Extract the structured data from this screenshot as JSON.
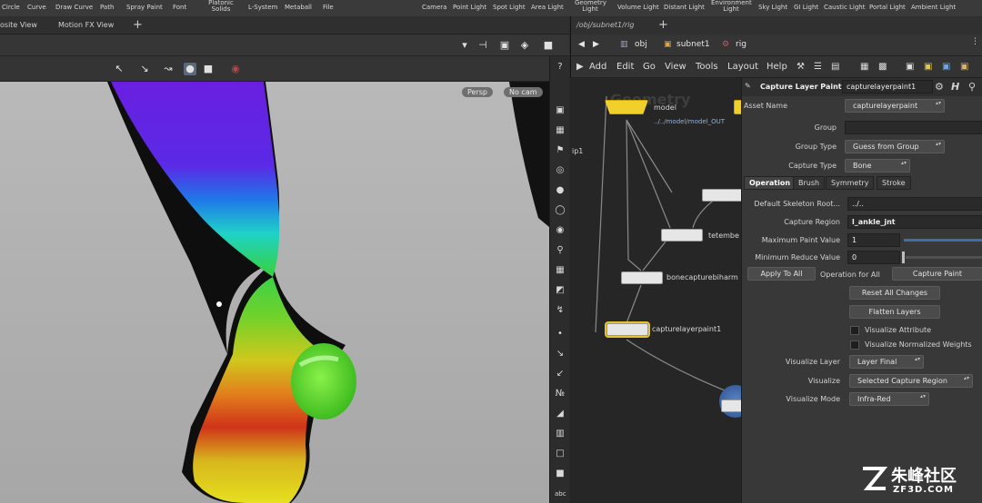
{
  "shelf": {
    "tools": [
      "Circle",
      "Curve",
      "Draw Curve",
      "Path",
      "Spray Paint",
      "Font",
      "Platonic Solids",
      "L-System",
      "Metaball",
      "File",
      "Camera",
      "Point Light",
      "Spot Light",
      "Area Light",
      "Geometry Light",
      "Volume Light",
      "Distant Light",
      "Environment Light",
      "Sky Light",
      "GI Light",
      "Caustic Light",
      "Portal Light",
      "Ambient Light"
    ]
  },
  "left_pane": {
    "tabs": [
      "osite View",
      "Motion FX View"
    ],
    "viewport": {
      "persp_label": "Persp",
      "cam_label": "No cam"
    }
  },
  "right_pane": {
    "tab": "/obj/subnet1/rig",
    "path": [
      "obj",
      "subnet1",
      "rig"
    ],
    "menu": [
      "Add",
      "Edit",
      "Go",
      "View",
      "Tools",
      "Layout",
      "Help"
    ]
  },
  "network": {
    "title": "Geometry",
    "model_node": "model",
    "model_path": "../../model/model_OUT",
    "stub_label": "ip1",
    "nodes": [
      "tetembe",
      "bonecapturebiharm",
      "capturelayerpaint1"
    ]
  },
  "params": {
    "header_title": "Capture Layer Paint",
    "header_node": "capturelayerpaint1",
    "asset_name_label": "Asset Name",
    "asset_name": "capturelayerpaint",
    "group_label": "Group",
    "group_value": "",
    "group_type_label": "Group Type",
    "group_type": "Guess from Group",
    "capture_type_label": "Capture Type",
    "capture_type": "Bone",
    "tabs": [
      "Operation",
      "Brush",
      "Symmetry",
      "Stroke"
    ],
    "skeleton_root_label": "Default Skeleton Root...",
    "skeleton_root": "../..",
    "capture_region_label": "Capture Region",
    "capture_region": "l_ankle_jnt",
    "max_paint_label": "Maximum Paint Value",
    "max_paint": "1",
    "min_reduce_label": "Minimum Reduce Value",
    "min_reduce": "0",
    "apply_all": "Apply To All",
    "operation_all_label": "Operation for All",
    "operation_all": "Capture Paint",
    "reset_all": "Reset All Changes",
    "flatten": "Flatten Layers",
    "visualize_attribute": "Visualize Attribute",
    "visualize_normalized": "Visualize Normalized Weights",
    "visualize_layer_label": "Visualize Layer",
    "visualize_layer": "Layer Final",
    "visualize_label": "Visualize",
    "visualize": "Selected Capture Region",
    "visualize_mode_label": "Visualize Mode",
    "visualize_mode": "Infra-Red"
  },
  "watermark": {
    "cn": "朱峰社区",
    "url": "ZF3D.COM"
  }
}
